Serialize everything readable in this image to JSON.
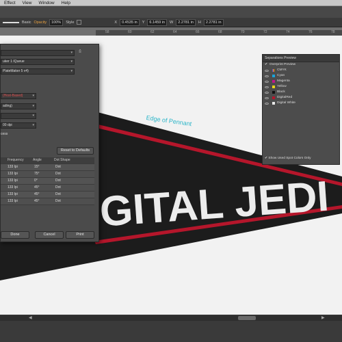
{
  "menu": [
    "Effect",
    "View",
    "Window",
    "Help"
  ],
  "toolbar": {
    "brush": "Basic",
    "opacity_label": "Opacity",
    "opacity_value": "100%",
    "style_label": "Style",
    "x_label": "X",
    "x_value": "0.4535 in",
    "y_label": "Y",
    "y_value": "6.1459 in",
    "w_label": "W",
    "w_value": "2.2781 in",
    "h_label": "H",
    "h_value": "2.2781 in"
  },
  "ruler": [
    "58",
    "60",
    "62",
    "64",
    "66",
    "68",
    "70",
    "72",
    "74",
    "76",
    "78"
  ],
  "print_dialog": {
    "printer_value": "uker 1 IQueue",
    "ppd_value": "PlateMaker 5 v4)",
    "mode_value": "(Host-Based)",
    "emulsion_value": "ading)",
    "image_value": "",
    "resolution_value": "00 dpi",
    "process_label": "cess",
    "reset_button": "Reset to Defaults",
    "ink_columns": [
      "Frequency",
      "Angle",
      "Dot Shape"
    ],
    "ink_rows": [
      [
        "133 lpi",
        "15°",
        "Dot"
      ],
      [
        "133 lpi",
        "75°",
        "Dot"
      ],
      [
        "133 lpi",
        "0°",
        "Dot"
      ],
      [
        "133 lpi",
        "45°",
        "Dot"
      ],
      [
        "133 lpi",
        "45°",
        "Dot"
      ],
      [
        "133 lpi",
        "45°",
        "Dot"
      ]
    ],
    "done_button": "Done",
    "cancel_button": "Cancel",
    "print_button": "Print"
  },
  "separations_panel": {
    "title": "Separations Preview",
    "overprint_label": "Overprint Preview",
    "inks": [
      {
        "name": "CMYK",
        "color": "#888888"
      },
      {
        "name": "Cyan",
        "color": "#1aa3d9"
      },
      {
        "name": "Magenta",
        "color": "#c0158a"
      },
      {
        "name": "Yellow",
        "color": "#e8d51a"
      },
      {
        "name": "Black",
        "color": "#111111"
      },
      {
        "name": "DigitalRed",
        "color": "#b5162b"
      },
      {
        "name": "Digital White",
        "color": "#e8e8e8"
      }
    ],
    "footer_label": "Show Used Spot Colors Only"
  },
  "artwork": {
    "annotation": "Edge of Pennant",
    "pennant_text": "GITAL JEDI",
    "colors": {
      "pennant": "#1c1c1c",
      "stripe": "#b5162b",
      "text": "#ececec",
      "annotation": "#2bb5c8"
    }
  }
}
